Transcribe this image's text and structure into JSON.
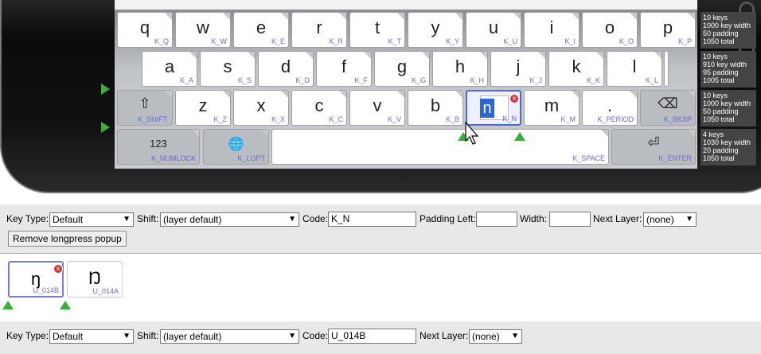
{
  "keyboard": {
    "rows": [
      [
        {
          "cap": "q",
          "code": "K_Q"
        },
        {
          "cap": "w",
          "code": "K_W"
        },
        {
          "cap": "e",
          "code": "K_E"
        },
        {
          "cap": "r",
          "code": "K_R"
        },
        {
          "cap": "t",
          "code": "K_T"
        },
        {
          "cap": "y",
          "code": "K_Y"
        },
        {
          "cap": "u",
          "code": "K_U"
        },
        {
          "cap": "i",
          "code": "K_I"
        },
        {
          "cap": "o",
          "code": "K_O"
        },
        {
          "cap": "p",
          "code": "K_P"
        }
      ],
      [
        {
          "cap": "a",
          "code": "K_A"
        },
        {
          "cap": "s",
          "code": "K_S"
        },
        {
          "cap": "d",
          "code": "K_D"
        },
        {
          "cap": "f",
          "code": "K_F"
        },
        {
          "cap": "g",
          "code": "K_G"
        },
        {
          "cap": "h",
          "code": "K_H"
        },
        {
          "cap": "j",
          "code": "K_J"
        },
        {
          "cap": "k",
          "code": "K_K"
        },
        {
          "cap": "l",
          "code": "K_L"
        }
      ],
      [
        {
          "cap": "⇧",
          "code": "K_SHIFT"
        },
        {
          "cap": "z",
          "code": "K_Z"
        },
        {
          "cap": "x",
          "code": "K_X"
        },
        {
          "cap": "c",
          "code": "K_C"
        },
        {
          "cap": "v",
          "code": "K_V"
        },
        {
          "cap": "b",
          "code": "K_B"
        },
        {
          "cap": "n",
          "code": "K_N"
        },
        {
          "cap": "m",
          "code": "K_M"
        },
        {
          "cap": ".",
          "code": "K_PERIOD"
        },
        {
          "cap": "⌫",
          "code": "K_BKSP"
        }
      ],
      [
        {
          "cap": "123",
          "code": "K_NUMLOCK"
        },
        {
          "cap": "🌐",
          "code": "K_LOPT"
        },
        {
          "cap": "",
          "code": "K_SPACE"
        },
        {
          "cap": "⏎",
          "code": "K_ENTER"
        }
      ]
    ],
    "row_info": [
      [
        "10 keys",
        "1000 key width",
        "50 padding",
        "1050 total"
      ],
      [
        "10 keys",
        "910 key width",
        "95 padding",
        "1005 total"
      ],
      [
        "10 keys",
        "1000 key width",
        "50 padding",
        "1050 total"
      ],
      [
        "4 keys",
        "1030 key width",
        "20 padding",
        "1050 total"
      ]
    ]
  },
  "key_panel": {
    "key_type_label": "Key Type:",
    "key_type_value": "Default",
    "shift_label": "Shift:",
    "shift_value": "(layer default)",
    "code_label": "Code:",
    "code_value": "K_N",
    "padding_left_label": "Padding Left:",
    "padding_left_value": "",
    "width_label": "Width:",
    "width_value": "",
    "next_layer_label": "Next Layer:",
    "next_layer_value": "(none)",
    "remove_button": "Remove longpress popup"
  },
  "longpress": {
    "keys": [
      {
        "cap": "ŋ",
        "code": "U_014B"
      },
      {
        "cap": "Ŋ",
        "code": "U_014A"
      }
    ]
  },
  "subkey_panel": {
    "key_type_label": "Key Type:",
    "key_type_value": "Default",
    "shift_label": "Shift:",
    "shift_value": "(layer default)",
    "code_label": "Code:",
    "code_value": "U_014B",
    "next_layer_label": "Next Layer:",
    "next_layer_value": "(none)"
  },
  "colors": {
    "accent": "#4a6bd8",
    "add": "#39b03b",
    "remove": "#d33333",
    "code": "#6a6ad0"
  }
}
